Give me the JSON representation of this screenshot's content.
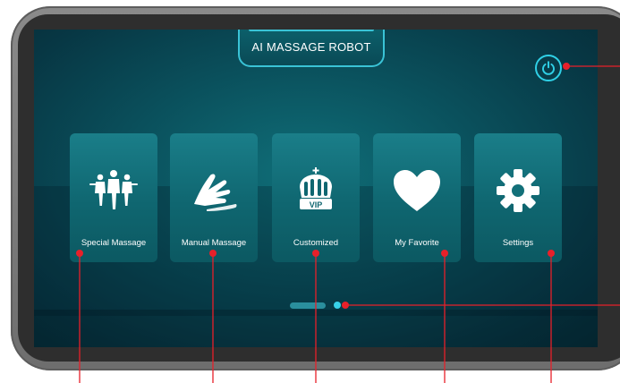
{
  "header": {
    "title": "AI MASSAGE ROBOT"
  },
  "power": {
    "icon": "power-icon"
  },
  "tiles": [
    {
      "label": "Special Massage",
      "icon": "people-group-icon"
    },
    {
      "label": "Manual Massage",
      "icon": "hands-icon"
    },
    {
      "label": "Customized",
      "icon": "vip-crown-icon"
    },
    {
      "label": "My Favorite",
      "icon": "heart-icon"
    },
    {
      "label": "Settings",
      "icon": "gear-icon"
    }
  ],
  "pager": {
    "pages": 2,
    "current_page": 1
  },
  "colors": {
    "accent": "#37d3ea",
    "screen_bg": "#0a4f5b",
    "tile_bg": "#137079",
    "callout": "#e8202a",
    "device_frame": "#7a7a7a"
  }
}
